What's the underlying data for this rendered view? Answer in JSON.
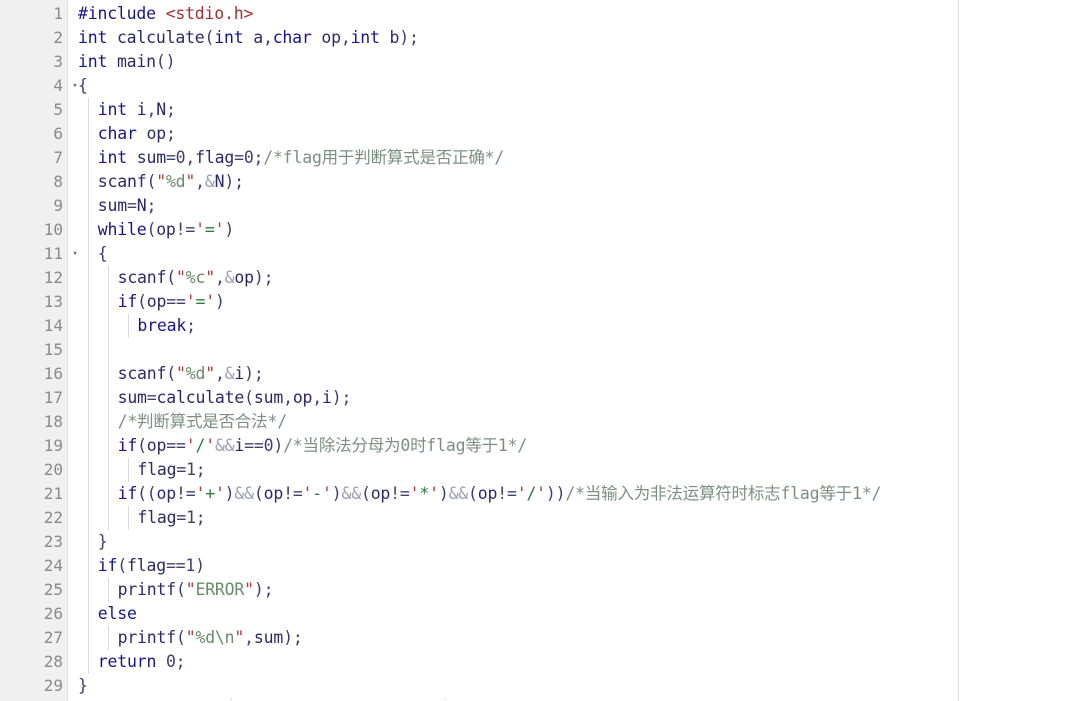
{
  "editor": {
    "language": "C",
    "gutter": {
      "fold_marker": "▾",
      "fold_lines": [
        4,
        11
      ],
      "line_numbers": [
        1,
        2,
        3,
        4,
        5,
        6,
        7,
        8,
        9,
        10,
        11,
        12,
        13,
        14,
        15,
        16,
        17,
        18,
        19,
        20,
        21,
        22,
        23,
        24,
        25,
        26,
        27,
        28,
        29
      ]
    },
    "colors": {
      "background": "#ffffff",
      "gutter_background": "#f0f0f0",
      "line_number": "#8a8a8a",
      "keyword": "#16168c",
      "preprocessor": "#16168c",
      "include_path": "#a33030",
      "string": "#6a8a6a",
      "quote": "#b03838",
      "char_literal": "#2f7a3f",
      "comment": "#7c8f80",
      "plain_text": "#2a2a6a",
      "indent_guide": "#d8d8dd",
      "ruler": "#dcdcdc"
    },
    "lines": [
      {
        "n": 1,
        "indent": 0,
        "text": "#include <stdio.h>"
      },
      {
        "n": 2,
        "indent": 0,
        "text": "int calculate(int a,char op,int b);"
      },
      {
        "n": 3,
        "indent": 0,
        "text": "int main()"
      },
      {
        "n": 4,
        "indent": 0,
        "text": "{"
      },
      {
        "n": 5,
        "indent": 1,
        "text": "int i,N;"
      },
      {
        "n": 6,
        "indent": 1,
        "text": "char op;"
      },
      {
        "n": 7,
        "indent": 1,
        "text": "int sum=0,flag=0;/*flag用于判断算式是否正确*/"
      },
      {
        "n": 8,
        "indent": 1,
        "text": "scanf(\"%d\",&N);"
      },
      {
        "n": 9,
        "indent": 1,
        "text": "sum=N;"
      },
      {
        "n": 10,
        "indent": 1,
        "text": "while(op!='=')"
      },
      {
        "n": 11,
        "indent": 1,
        "text": "{"
      },
      {
        "n": 12,
        "indent": 2,
        "text": "scanf(\"%c\",&op);"
      },
      {
        "n": 13,
        "indent": 2,
        "text": "if(op=='=')"
      },
      {
        "n": 14,
        "indent": 3,
        "text": "break;"
      },
      {
        "n": 15,
        "indent": 2,
        "text": ""
      },
      {
        "n": 16,
        "indent": 2,
        "text": "scanf(\"%d\",&i);"
      },
      {
        "n": 17,
        "indent": 2,
        "text": "sum=calculate(sum,op,i);"
      },
      {
        "n": 18,
        "indent": 2,
        "text": "/*判断算式是否合法*/"
      },
      {
        "n": 19,
        "indent": 2,
        "text": "if(op=='/'&&i==0)/*当除法分母为0时flag等于1*/"
      },
      {
        "n": 20,
        "indent": 3,
        "text": "flag=1;"
      },
      {
        "n": 21,
        "indent": 2,
        "text": "if((op!='+')&&(op!='-')&&(op!='*')&&(op!='/'))/*当输入为非法运算符时标志flag等于1*/"
      },
      {
        "n": 22,
        "indent": 3,
        "text": "flag=1;"
      },
      {
        "n": 23,
        "indent": 1,
        "text": "}"
      },
      {
        "n": 24,
        "indent": 1,
        "text": "if(flag==1)"
      },
      {
        "n": 25,
        "indent": 2,
        "text": "printf(\"ERROR\");"
      },
      {
        "n": 26,
        "indent": 1,
        "text": "else"
      },
      {
        "n": 27,
        "indent": 2,
        "text": "printf(\"%d\\n\",sum);"
      },
      {
        "n": 28,
        "indent": 1,
        "text": "return 0;"
      },
      {
        "n": 29,
        "indent": 0,
        "text": "}"
      }
    ],
    "tokens": {
      "keywords": [
        "int",
        "char",
        "while",
        "if",
        "else",
        "break",
        "return"
      ],
      "functions": [
        "calculate",
        "main",
        "scanf",
        "printf"
      ],
      "strings": [
        "\"%d\"",
        "\"%c\"",
        "\"ERROR\"",
        "\"%d\\n\""
      ],
      "char_literals": [
        "'='",
        "'/'",
        "'+'",
        "'-'",
        "'*'"
      ],
      "comments": [
        "/*flag用于判断算式是否正确*/",
        "/*判断算式是否合法*/",
        "/*当除法分母为0时flag等于1*/",
        "/*当输入为非法运算符时标志flag等于1*/"
      ],
      "include_header": "<stdio.h>"
    }
  }
}
